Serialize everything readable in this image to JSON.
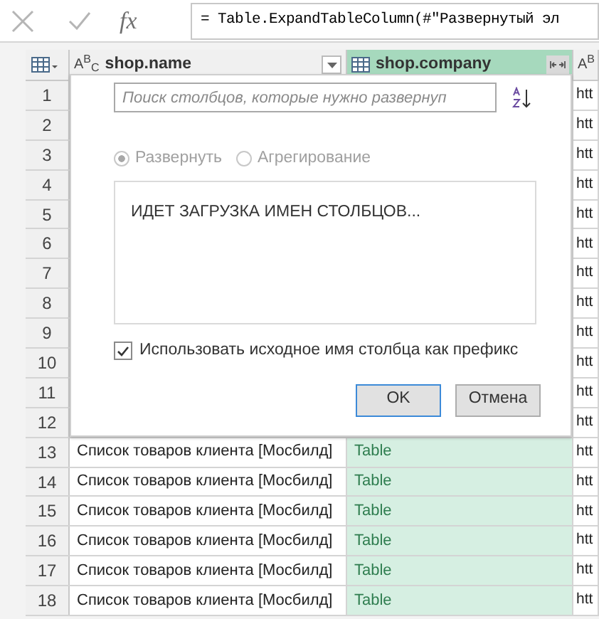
{
  "formula_bar": {
    "function_label": "fx",
    "formula": "= Table.ExpandTableColumn(#\"Развернутый эл"
  },
  "columns": [
    {
      "name": "shop.name",
      "kind": "text",
      "type_label": "A$^{B}$$_{C}$",
      "selected": false
    },
    {
      "name": "shop.company",
      "kind": "table",
      "selected": true
    },
    {
      "kind": "text",
      "type_label": "A$^{B}$",
      "selected": false
    }
  ],
  "rows": [
    {
      "number": "1",
      "column_3": "htt"
    },
    {
      "number": "2",
      "column_3": "htt"
    },
    {
      "number": "3",
      "column_3": "htt"
    },
    {
      "number": "4",
      "column_3": "htt"
    },
    {
      "number": "5",
      "column_3": "htt"
    },
    {
      "number": "6",
      "column_3": "htt"
    },
    {
      "number": "7",
      "column_3": "htt"
    },
    {
      "number": "8",
      "column_3": "htt"
    },
    {
      "number": "9",
      "column_3": "htt"
    },
    {
      "number": "10",
      "column_3": "htt"
    },
    {
      "number": "11",
      "column_3": "htt"
    },
    {
      "number": "12",
      "column_3": "htt"
    },
    {
      "number": "13",
      "shop_name": "Список товаров клиента [Мосбилд]",
      "shop_company": "Table",
      "column_3": "htt"
    },
    {
      "number": "14",
      "shop_name": "Список товаров клиента [Мосбилд]",
      "shop_company": "Table",
      "column_3": "htt"
    },
    {
      "number": "15",
      "shop_name": "Список товаров клиента [Мосбилд]",
      "shop_company": "Table",
      "column_3": "htt"
    },
    {
      "number": "16",
      "shop_name": "Список товаров клиента [Мосбилд]",
      "shop_company": "Table",
      "column_3": "htt"
    },
    {
      "number": "17",
      "shop_name": "Список товаров клиента [Мосбилд]",
      "shop_company": "Table",
      "column_3": "htt"
    },
    {
      "number": "18",
      "shop_name": "Список товаров клиента [Мосбилд]",
      "shop_company": "Table",
      "column_3": "htt"
    }
  ],
  "expand_dialog": {
    "search": {
      "placeholder": "Поиск столбцов, которые нужно развернуп"
    },
    "modes_disabled": true,
    "modes": [
      {
        "label": "Развернуть",
        "selected": true
      },
      {
        "label": "Агрегирование",
        "selected": false
      }
    ],
    "list_message": "ИДЕТ ЗАГРУЗКА ИМЕН СТОЛБЦОВ...",
    "prefix_option": {
      "label": "Использовать исходное имя столбца как префикс",
      "checked": true
    },
    "buttons": [
      {
        "label": "OK",
        "default": true
      },
      {
        "label": "Отмена",
        "default": false
      }
    ]
  }
}
